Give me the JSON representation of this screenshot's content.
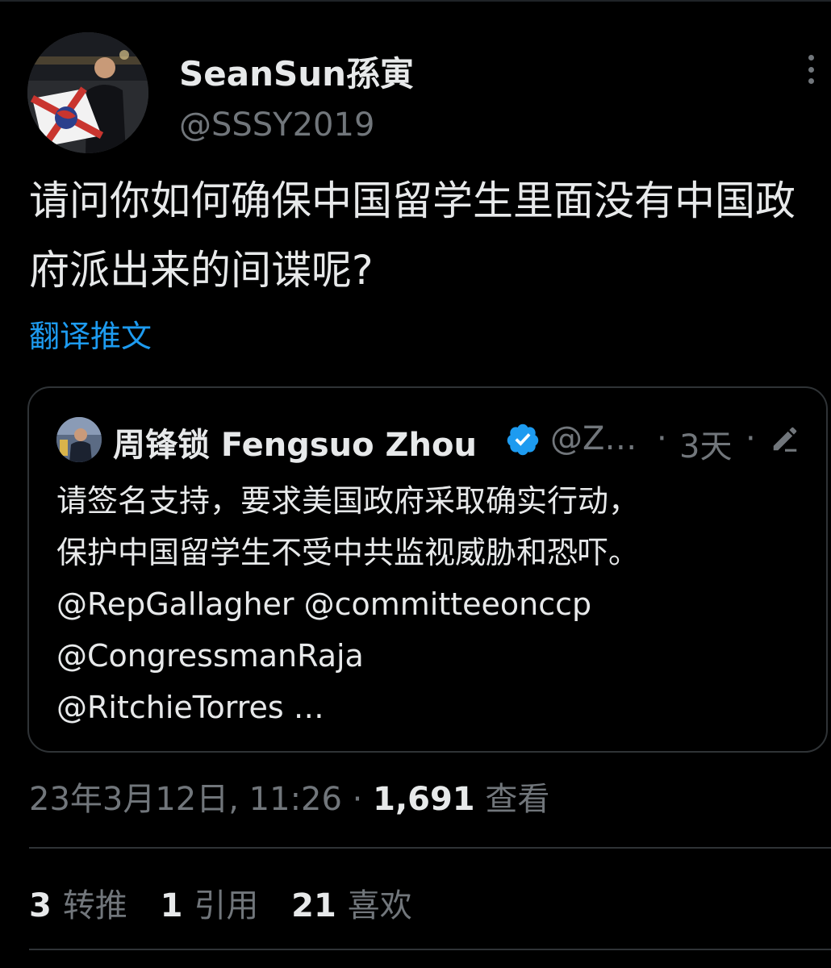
{
  "author": {
    "display_name": "SeanSun孫寅",
    "handle": "@SSSY2019"
  },
  "tweet": {
    "text": "请问你如何确保中国留学生里面没有中国政府派出来的间谍呢?",
    "translate_label": "翻译推文"
  },
  "quoted_tweet": {
    "display_name": "周锋锁 Fengsuo Zhou",
    "handle": "@Z…",
    "time": "3天",
    "lines": [
      "请签名支持，要求美国政府采取确实行动，",
      "保护中国留学生不受中共监视威胁和恐吓。",
      "@RepGallagher @committeeonccp",
      "@CongressmanRaja",
      "@RitchieTorres …"
    ]
  },
  "meta": {
    "datetime": "23年3月12日, 11:26",
    "separator": "·",
    "views_count": "1,691",
    "views_label": "查看"
  },
  "stats": {
    "retweets_count": "3",
    "retweets_label": "转推",
    "quotes_count": "1",
    "quotes_label": "引用",
    "likes_count": "21",
    "likes_label": "喜欢"
  },
  "icons": {
    "verified": "verified-badge-icon",
    "more": "more-options-icon",
    "edited": "edit-pencil-icon"
  },
  "colors": {
    "background": "#000000",
    "text": "#e7e9ea",
    "secondary": "#71767b",
    "link": "#1d9bf0",
    "border": "#2f3336"
  }
}
